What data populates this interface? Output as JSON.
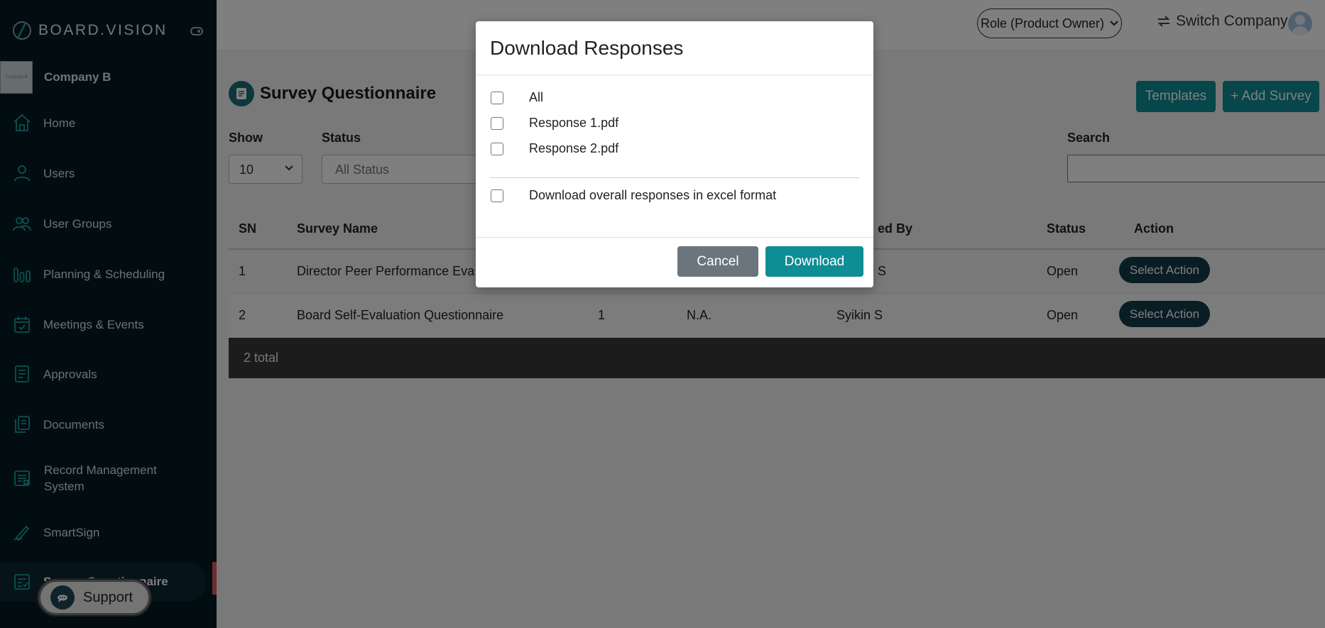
{
  "sidebar": {
    "logo_text": "BOARD.VISION",
    "company_logo_text": "Company B",
    "company_name": "Company B",
    "items": [
      {
        "label": "Home",
        "icon": "home-icon"
      },
      {
        "label": "Users",
        "icon": "user-icon"
      },
      {
        "label": "User Groups",
        "icon": "user-groups-icon"
      },
      {
        "label": "Planning & Scheduling",
        "icon": "planning-icon"
      },
      {
        "label": "Meetings & Events",
        "icon": "calendar-icon"
      },
      {
        "label": "Approvals",
        "icon": "approvals-icon"
      },
      {
        "label": "Documents",
        "icon": "documents-icon"
      },
      {
        "label": "Record Management System",
        "icon": "record-management-icon"
      },
      {
        "label": "SmartSign",
        "icon": "pen-icon"
      },
      {
        "label": "Survey Questionnaire",
        "icon": "survey-icon"
      }
    ],
    "support_label": "Support"
  },
  "topbar": {
    "role_label": "Role (Product Owner)",
    "switch_company_label": "Switch Company"
  },
  "page": {
    "title": "Survey Questionnaire",
    "templates_label": "Templates",
    "add_survey_label": "+ Add Survey",
    "show_label": "Show",
    "show_value": "10",
    "status_label": "Status",
    "status_value": "All Status",
    "search_label": "Search"
  },
  "table": {
    "headers": [
      "SN",
      "Survey Name",
      "ed By",
      "Status",
      "Action"
    ],
    "rows": [
      {
        "sn": "1",
        "name": "Director Peer Performance Eva",
        "col3": "",
        "col4": "",
        "created_by": "S",
        "status": "Open",
        "action": "Select Action"
      },
      {
        "sn": "2",
        "name": "Board Self-Evaluation Questionnaire",
        "col3": "1",
        "col4": "N.A.",
        "created_by": "Syikin S",
        "status": "Open",
        "action": "Select Action"
      }
    ],
    "footer": "2 total"
  },
  "modal": {
    "title": "Download Responses",
    "options": [
      "All",
      "Response 1.pdf",
      "Response 2.pdf"
    ],
    "excel_option": "Download overall responses in excel format",
    "cancel_label": "Cancel",
    "download_label": "Download"
  },
  "colors": {
    "sidebar_bg": "#051b24",
    "accent_teal": "#0f8d95",
    "icon_teal": "#1aa39e",
    "action_btn": "#133b4a"
  }
}
